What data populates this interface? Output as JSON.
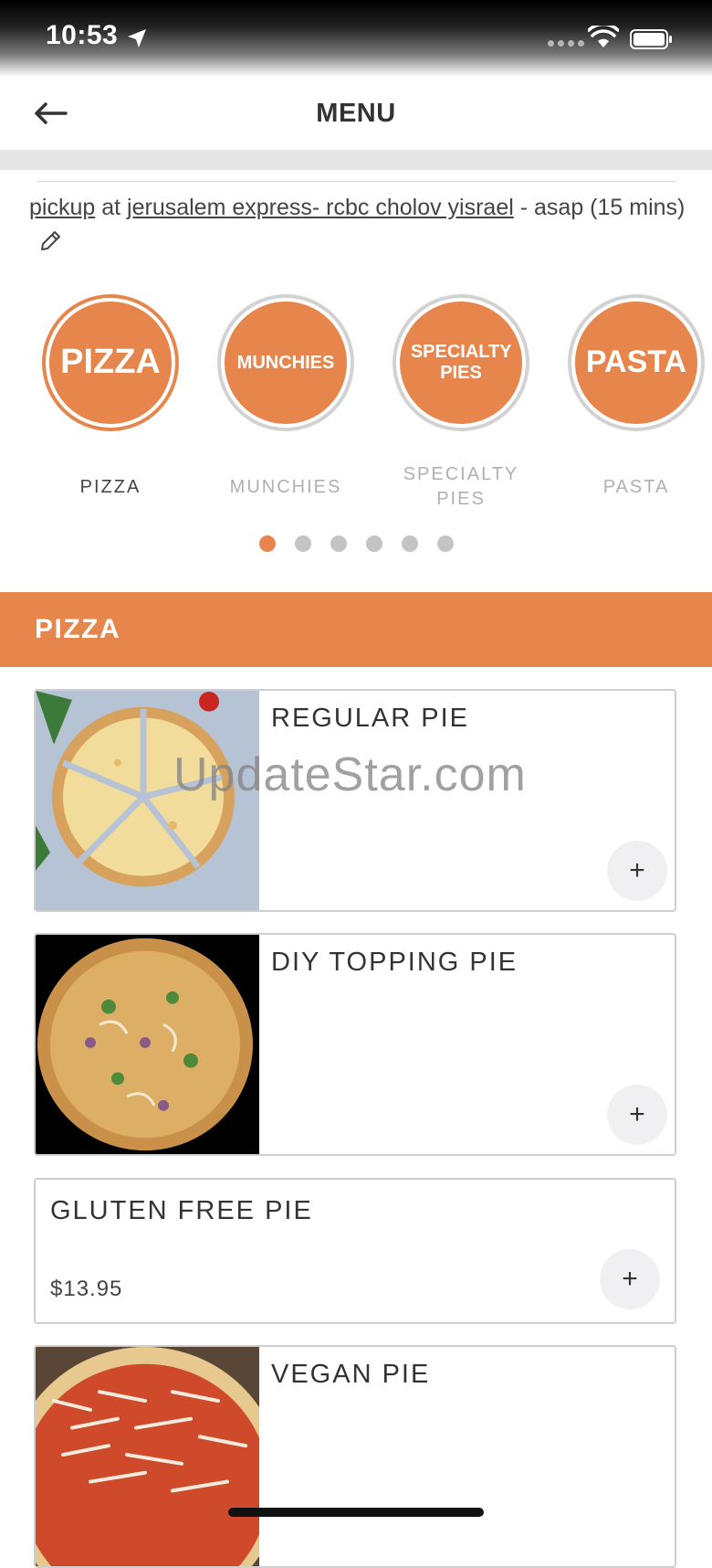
{
  "status_bar": {
    "time": "10:53"
  },
  "header": {
    "title": "MENU"
  },
  "pickup": {
    "mode": "pickup",
    "at": "at",
    "location": "jerusalem express- rcbc cholov yisrael",
    "timing": "- asap (15 mins)"
  },
  "categories": [
    {
      "circle_text": "PIZZA",
      "label": "PIZZA"
    },
    {
      "circle_text": "MUNCHIES",
      "label": "MUNCHIES"
    },
    {
      "circle_text": "SPECIALTY PIES",
      "label": "SPECIALTY PIES"
    },
    {
      "circle_text": "PASTA",
      "label": "PASTA"
    }
  ],
  "pagination": {
    "pages": 6,
    "active": 1
  },
  "section": {
    "title": "PIZZA"
  },
  "items": [
    {
      "name": "REGULAR PIE",
      "price": "",
      "add": "+"
    },
    {
      "name": "DIY TOPPING PIE",
      "price": "",
      "add": "+"
    },
    {
      "name": "GLUTEN FREE PIE",
      "price": "$13.95",
      "add": "+"
    },
    {
      "name": "VEGAN PIE",
      "price": "",
      "add": "+"
    }
  ],
  "watermark": "UpdateStar.com",
  "colors": {
    "accent": "#e6864c",
    "inactive_dot": "#c4c4c4",
    "divider": "#e6e6e6"
  }
}
